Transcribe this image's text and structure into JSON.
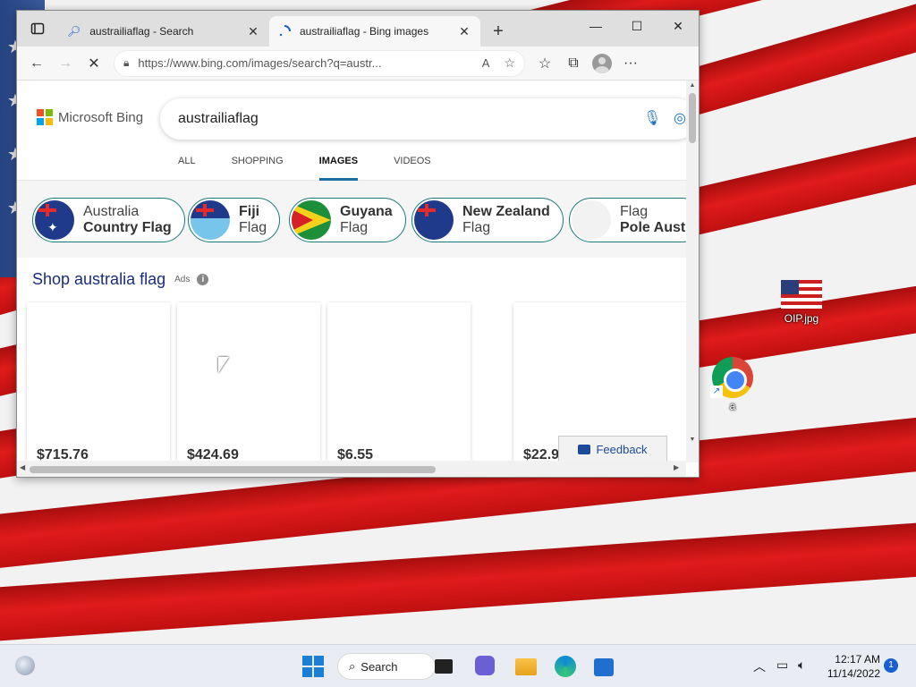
{
  "browser": {
    "tabs": [
      {
        "title": "austrailiaflag - Search",
        "icon": "search-icon"
      },
      {
        "title": "austrailiaflag - Bing images",
        "icon": "loading-spinner-icon"
      }
    ],
    "address_url": "https://www.bing.com/images/search?q=austr..."
  },
  "bing": {
    "logo_text": "Microsoft Bing",
    "query": "austrailiaflag",
    "nav_tabs": [
      "ALL",
      "SHOPPING",
      "IMAGES",
      "VIDEOS"
    ],
    "active_tab": "IMAGES",
    "chips": [
      {
        "line1": "Australia",
        "line2": "Country Flag",
        "bold_line": 2
      },
      {
        "line1": "Fiji",
        "line2": "Flag",
        "bold_line": 1
      },
      {
        "line1": "Guyana",
        "line2": "Flag",
        "bold_line": 1
      },
      {
        "line1": "New Zealand",
        "line2": "Flag",
        "bold_line": 1
      },
      {
        "line1": "Flag",
        "line2": "Pole Austr",
        "bold_line": 2
      }
    ],
    "shop_title": "Shop australia flag",
    "ads_label": "Ads",
    "products": [
      {
        "price": "$715.76"
      },
      {
        "price": "$424.69"
      },
      {
        "price": "$6.55"
      },
      {
        "price": "$22.9"
      }
    ],
    "feedback_label": "Feedback"
  },
  "desktop": {
    "icons": [
      {
        "label": "OIP.jpg"
      },
      {
        "label": "a"
      }
    ]
  },
  "taskbar": {
    "search_label": "Search",
    "time": "12:17 AM",
    "date": "11/14/2022",
    "notification_count": "1"
  },
  "colors": {
    "bing_accent": "#1a6fa0",
    "link_blue": "#1a2d7a",
    "chip_border": "#1a7a7a"
  }
}
